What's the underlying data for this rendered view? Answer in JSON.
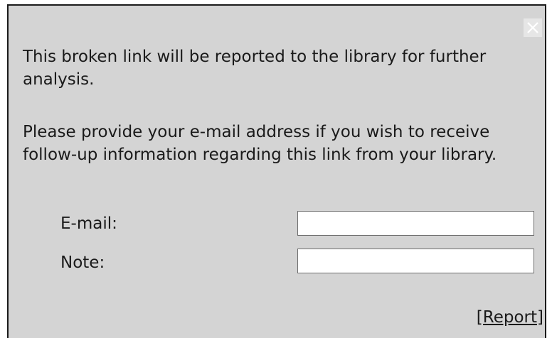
{
  "dialog": {
    "message_1": "This broken link will be reported to the library for further analysis.",
    "message_2": "Please provide your e-mail address if you wish to receive follow-up information regarding this link from your library.",
    "close_icon": "close-x-icon"
  },
  "form": {
    "email_label": "E-mail:",
    "email_value": "",
    "note_label": "Note:",
    "note_value": ""
  },
  "actions": {
    "report_label": "[Report]"
  },
  "colors": {
    "background": "#d4d4d4",
    "border": "#1a1a1a",
    "close_button_bg": "#e6e6e6",
    "input_bg": "#ffffff"
  }
}
